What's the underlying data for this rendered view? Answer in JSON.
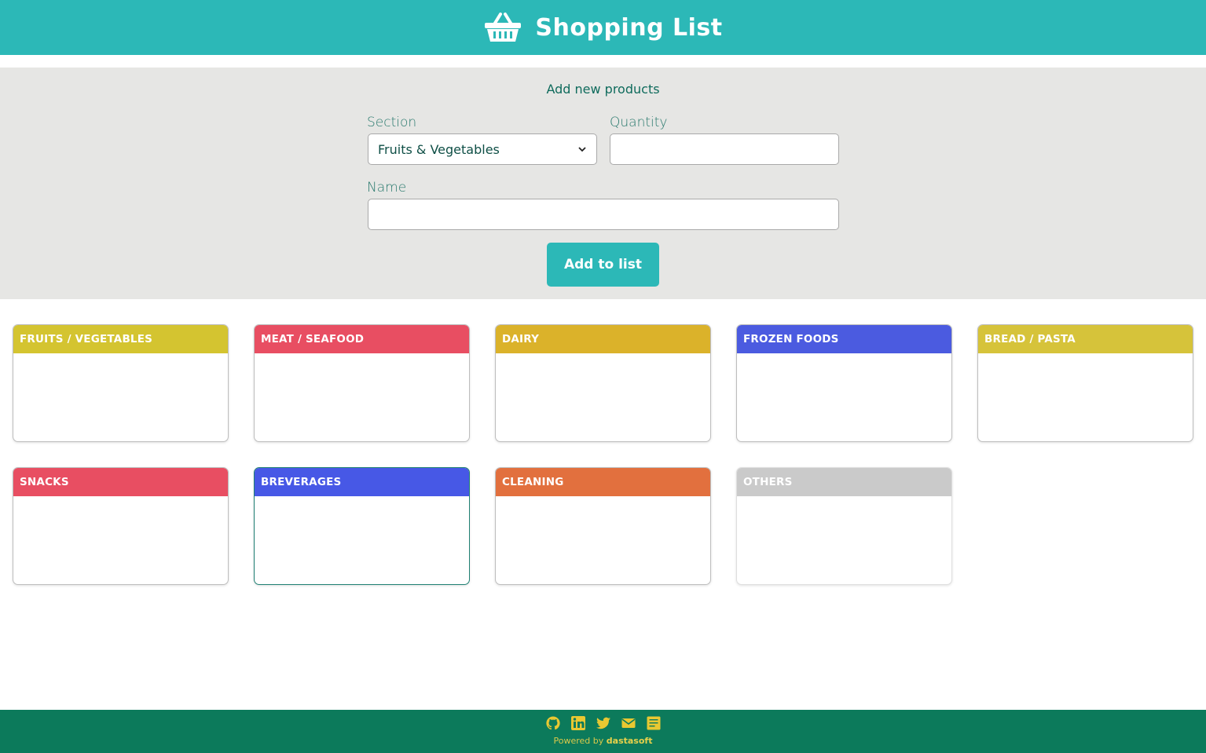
{
  "header": {
    "title": "Shopping List"
  },
  "form": {
    "title": "Add new products",
    "section_label": "Section",
    "section_value": "Fruits & Vegetables",
    "quantity_label": "Quantity",
    "quantity_value": "",
    "name_label": "Name",
    "name_value": "",
    "submit_label": "Add to list"
  },
  "sections": [
    {
      "label": "FRUITS / VEGETABLES",
      "color": "#d4c430"
    },
    {
      "label": "MEAT / SEAFOOD",
      "color": "#e84e62"
    },
    {
      "label": "DAIRY",
      "color": "#dbb22a"
    },
    {
      "label": "FROZEN FOODS",
      "color": "#4b5be0"
    },
    {
      "label": "BREAD / PASTA",
      "color": "#d6c33a"
    },
    {
      "label": "SNACKS",
      "color": "#e84e62"
    },
    {
      "label": "BREVERAGES",
      "color": "#4758e6"
    },
    {
      "label": "CLEANING",
      "color": "#e2703e"
    },
    {
      "label": "OTHERS",
      "color": "#cacaca"
    }
  ],
  "footer": {
    "icons": [
      "github-icon",
      "linkedin-icon",
      "twitter-icon",
      "mail-icon",
      "cv-icon"
    ],
    "powered_prefix": "Powered by",
    "powered_brand": "dastasoft"
  },
  "colors": {
    "header_bg": "#2cb8b7",
    "panel_bg": "#e6e6e4",
    "footer_bg": "#0c7a5b",
    "footer_accent": "#e8d14a"
  }
}
